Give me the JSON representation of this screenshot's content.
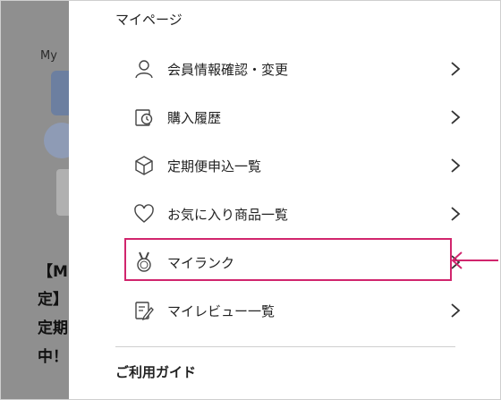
{
  "background": {
    "my": "My",
    "lines": [
      "【M",
      "定】",
      "定期",
      "中！"
    ]
  },
  "mypage": {
    "title": "マイページ",
    "items": [
      {
        "label": "会員情報確認・変更",
        "icon": "user-icon"
      },
      {
        "label": "購入履歴",
        "icon": "purchase-history-icon"
      },
      {
        "label": "定期便申込一覧",
        "icon": "box-icon"
      },
      {
        "label": "お気に入り商品一覧",
        "icon": "heart-icon"
      },
      {
        "label": "マイランク",
        "icon": "medal-icon"
      },
      {
        "label": "マイレビュー一覧",
        "icon": "review-icon"
      }
    ]
  },
  "guide": {
    "title": "ご利用ガイド"
  },
  "colors": {
    "highlight": "#d1256d",
    "overlay": "#8f8f8f"
  }
}
